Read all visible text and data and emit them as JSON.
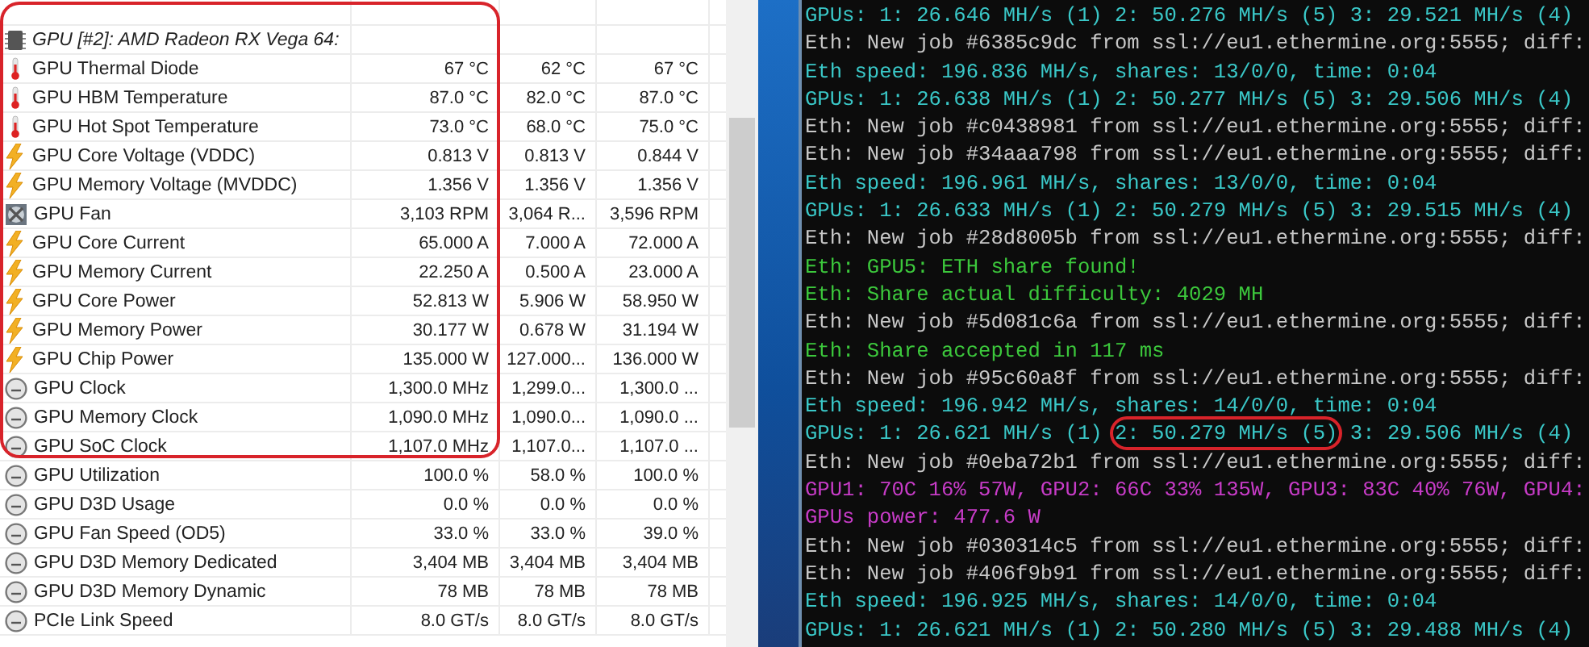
{
  "sensor_panel": {
    "header": {
      "label": "GPU [#2]: AMD Radeon RX Vega 64:",
      "kind": "chip",
      "highlighted": true
    },
    "rows": [
      {
        "kind": "temperature",
        "label": "GPU Thermal Diode",
        "current": "67 °C",
        "minimum": "62 °C",
        "maximum": "67 °C",
        "highlighted": true
      },
      {
        "kind": "temperature",
        "label": "GPU HBM Temperature",
        "current": "87.0 °C",
        "minimum": "82.0 °C",
        "maximum": "87.0 °C",
        "highlighted": true
      },
      {
        "kind": "temperature",
        "label": "GPU Hot Spot Temperature",
        "current": "73.0 °C",
        "minimum": "68.0 °C",
        "maximum": "75.0 °C",
        "highlighted": true
      },
      {
        "kind": "power",
        "label": "GPU Core Voltage (VDDC)",
        "current": "0.813 V",
        "minimum": "0.813 V",
        "maximum": "0.844 V",
        "highlighted": true
      },
      {
        "kind": "power",
        "label": "GPU Memory Voltage (MVDDC)",
        "current": "1.356 V",
        "minimum": "1.356 V",
        "maximum": "1.356 V",
        "highlighted": true
      },
      {
        "kind": "fan",
        "label": "GPU Fan",
        "current": "3,103 RPM",
        "minimum": "3,064 R...",
        "maximum": "3,596 RPM",
        "highlighted": true
      },
      {
        "kind": "power",
        "label": "GPU Core Current",
        "current": "65.000 A",
        "minimum": "7.000 A",
        "maximum": "72.000 A",
        "highlighted": true
      },
      {
        "kind": "power",
        "label": "GPU Memory Current",
        "current": "22.250 A",
        "minimum": "0.500 A",
        "maximum": "23.000 A",
        "highlighted": true
      },
      {
        "kind": "power",
        "label": "GPU Core Power",
        "current": "52.813 W",
        "minimum": "5.906 W",
        "maximum": "58.950 W",
        "highlighted": true
      },
      {
        "kind": "power",
        "label": "GPU Memory Power",
        "current": "30.177 W",
        "minimum": "0.678 W",
        "maximum": "31.194 W",
        "highlighted": true
      },
      {
        "kind": "power",
        "label": "GPU Chip Power",
        "current": "135.000 W",
        "minimum": "127.000...",
        "maximum": "136.000 W",
        "highlighted": true
      },
      {
        "kind": "clock",
        "label": "GPU Clock",
        "current": "1,300.0 MHz",
        "minimum": "1,299.0...",
        "maximum": "1,300.0 ...",
        "highlighted": true
      },
      {
        "kind": "clock",
        "label": "GPU Memory Clock",
        "current": "1,090.0 MHz",
        "minimum": "1,090.0...",
        "maximum": "1,090.0 ...",
        "highlighted": true
      },
      {
        "kind": "clock",
        "label": "GPU SoC Clock",
        "current": "1,107.0 MHz",
        "minimum": "1,107.0...",
        "maximum": "1,107.0 ...",
        "highlighted": true
      },
      {
        "kind": "clock",
        "label": "GPU Utilization",
        "current": "100.0 %",
        "minimum": "58.0 %",
        "maximum": "100.0 %",
        "highlighted": false
      },
      {
        "kind": "clock",
        "label": "GPU D3D Usage",
        "current": "0.0 %",
        "minimum": "0.0 %",
        "maximum": "0.0 %",
        "highlighted": false
      },
      {
        "kind": "clock",
        "label": "GPU Fan Speed (OD5)",
        "current": "33.0 %",
        "minimum": "33.0 %",
        "maximum": "39.0 %",
        "highlighted": false
      },
      {
        "kind": "clock",
        "label": "GPU D3D Memory Dedicated",
        "current": "3,404 MB",
        "minimum": "3,404 MB",
        "maximum": "3,404 MB",
        "highlighted": false
      },
      {
        "kind": "clock",
        "label": "GPU D3D Memory Dynamic",
        "current": "78 MB",
        "minimum": "78 MB",
        "maximum": "78 MB",
        "highlighted": false
      },
      {
        "kind": "clock",
        "label": "PCIe Link Speed",
        "current": "8.0 GT/s",
        "minimum": "8.0 GT/s",
        "maximum": "8.0 GT/s",
        "highlighted": false
      }
    ]
  },
  "console": {
    "lines": [
      {
        "kind": "speed",
        "segments": [
          {
            "text": "GPUs: 1: 26.646 MH/s (1) 2: 50.276 MH/s (5) 3: 29.521 MH/s (4)",
            "highlighted": false
          }
        ]
      },
      {
        "kind": "job",
        "segments": [
          {
            "text": "Eth: New job #6385c9dc from ssl://eu1.ethermine.org:5555; diff:",
            "highlighted": false
          }
        ]
      },
      {
        "kind": "speed",
        "segments": [
          {
            "text": "Eth speed: 196.836 MH/s, shares: 13/0/0, time: 0:04",
            "highlighted": false
          }
        ]
      },
      {
        "kind": "speed",
        "segments": [
          {
            "text": "GPUs: 1: 26.638 MH/s (1) 2: 50.277 MH/s (5) 3: 29.506 MH/s (4)",
            "highlighted": false
          }
        ]
      },
      {
        "kind": "job",
        "segments": [
          {
            "text": "Eth: New job #c0438981 from ssl://eu1.ethermine.org:5555; diff:",
            "highlighted": false
          }
        ]
      },
      {
        "kind": "job",
        "segments": [
          {
            "text": "Eth: New job #34aaa798 from ssl://eu1.ethermine.org:5555; diff:",
            "highlighted": false
          }
        ]
      },
      {
        "kind": "speed",
        "segments": [
          {
            "text": "Eth speed: 196.961 MH/s, shares: 13/0/0, time: 0:04",
            "highlighted": false
          }
        ]
      },
      {
        "kind": "speed",
        "segments": [
          {
            "text": "GPUs: 1: 26.633 MH/s (1) 2: 50.279 MH/s (5) 3: 29.515 MH/s (4)",
            "highlighted": false
          }
        ]
      },
      {
        "kind": "job",
        "segments": [
          {
            "text": "Eth: New job #28d8005b from ssl://eu1.ethermine.org:5555; diff:",
            "highlighted": false
          }
        ]
      },
      {
        "kind": "share",
        "segments": [
          {
            "text": "Eth: GPU5: ETH share found!",
            "highlighted": false
          }
        ]
      },
      {
        "kind": "share",
        "segments": [
          {
            "text": "Eth: Share actual difficulty: 4029 MH",
            "highlighted": false
          }
        ]
      },
      {
        "kind": "job",
        "segments": [
          {
            "text": "Eth: New job #5d081c6a from ssl://eu1.ethermine.org:5555; diff:",
            "highlighted": false
          }
        ]
      },
      {
        "kind": "share",
        "segments": [
          {
            "text": "Eth: Share accepted in 117 ms",
            "highlighted": false
          }
        ]
      },
      {
        "kind": "job",
        "segments": [
          {
            "text": "Eth: New job #95c60a8f from ssl://eu1.ethermine.org:5555; diff:",
            "highlighted": false
          }
        ]
      },
      {
        "kind": "speed",
        "segments": [
          {
            "text": "Eth speed: 196.942 MH/s, shares: 14/0/0, time: 0:04",
            "highlighted": false
          }
        ]
      },
      {
        "kind": "speed",
        "segments": [
          {
            "text": "GPUs: 1: 26.621 MH/s (1) ",
            "highlighted": false
          },
          {
            "text": "2: 50.279 MH/s (5)",
            "highlighted": true
          },
          {
            "text": " 3: 29.506 MH/s (4)",
            "highlighted": false
          }
        ]
      },
      {
        "kind": "job",
        "segments": [
          {
            "text": "Eth: New job #0eba72b1 from ssl://eu1.ethermine.org:5555; diff:",
            "highlighted": false
          }
        ]
      },
      {
        "kind": "stats",
        "segments": [
          {
            "text": "GPU1: 70C 16% 57W, GPU2: 66C 33% 135W, GPU3: 83C 40% 76W, GPU4:",
            "highlighted": false
          }
        ]
      },
      {
        "kind": "stats",
        "segments": [
          {
            "text": "GPUs power: 477.6 W",
            "highlighted": false
          }
        ]
      },
      {
        "kind": "job",
        "segments": [
          {
            "text": "Eth: New job #030314c5 from ssl://eu1.ethermine.org:5555; diff:",
            "highlighted": false
          }
        ]
      },
      {
        "kind": "job",
        "segments": [
          {
            "text": "Eth: New job #406f9b91 from ssl://eu1.ethermine.org:5555; diff:",
            "highlighted": false
          }
        ]
      },
      {
        "kind": "speed",
        "segments": [
          {
            "text": "Eth speed: 196.925 MH/s, shares: 14/0/0, time: 0:04",
            "highlighted": false
          }
        ]
      },
      {
        "kind": "speed",
        "segments": [
          {
            "text": "GPUs: 1: 26.621 MH/s (1) 2: 50.280 MH/s (5) 3: 29.488 MH/s (4)",
            "highlighted": false
          }
        ]
      }
    ]
  }
}
